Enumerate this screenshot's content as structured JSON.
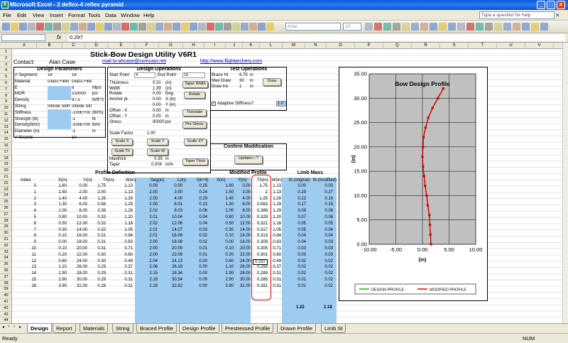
{
  "app": {
    "title": "Microsoft Excel - 2 deflex-4 reflex pyramid",
    "help_placeholder": "Type a question for help",
    "cell_value": "0.297",
    "font_name": "Arial",
    "font_size": "10",
    "fx": "fx"
  },
  "menu": [
    "File",
    "Edit",
    "View",
    "Insert",
    "Format",
    "Tools",
    "Data",
    "Window",
    "Help"
  ],
  "columns": [
    "A",
    "B",
    "C",
    "D",
    "E",
    "F",
    "G",
    "H",
    "I",
    "J",
    "K",
    "L",
    "M",
    "N",
    "O",
    "P",
    "Q",
    "R",
    "S",
    "T",
    "U",
    "V"
  ],
  "rows": [
    "1",
    "2",
    "3",
    "4",
    "5",
    "6",
    "7",
    "8",
    "9",
    "10",
    "11",
    "12",
    "13",
    "14",
    "15",
    "16",
    "17",
    "18",
    "19",
    "20",
    "21",
    "22",
    "23",
    "24",
    "25",
    "26",
    "27",
    "28",
    "29",
    "30",
    "31",
    "32",
    "33",
    "34",
    "35",
    "36",
    "37",
    "38",
    "39",
    "40",
    "41",
    "42",
    "43",
    "44"
  ],
  "sheet": {
    "title": "Stick-Bow Design Utility V6R1",
    "contact_label": "Contact:",
    "contact_name": "Alan Case",
    "email": "mail to:ahcase@comcast.net",
    "website": "http://www.flightarchery.com",
    "design_params": {
      "title": "Design Parameters",
      "rows": [
        {
          "label": "# Segments",
          "value": "16",
          "v2": "16"
        },
        {
          "label": "Material",
          "value": "Glass Fiber (GC",
          "v2": "Glass Fiber (GC-F"
        },
        {
          "label": "E",
          "value": "",
          "v2": "8",
          "unit": "Mpsi"
        },
        {
          "label": "MOR",
          "value": "",
          "v2": "210000",
          "unit": "psi"
        },
        {
          "label": "Density",
          "value": "",
          "v2": "97.5",
          "unit": "lb/ft^3"
        },
        {
          "label": "String",
          "value": "Infinite Stiffness",
          "v2": "Infinite Stiffness"
        },
        {
          "label": "Stiffness",
          "value": "",
          "v2": "-100E+00",
          "unit": "(lb/%)"
        },
        {
          "label": "Strength (lb)",
          "value": "",
          "v2": "-1",
          "unit": "lb"
        },
        {
          "label": "Density(lb/in)",
          "value": "",
          "v2": "-100E+00",
          "unit": "lb/in"
        },
        {
          "label": "Diameter (in)",
          "value": "",
          "v2": "-1",
          "unit": "in"
        },
        {
          "label": "# Strands",
          "value": "",
          "v2": "10",
          "unit": ""
        }
      ]
    },
    "design_ops": {
      "title": "Design Operations",
      "start_label": "Start Point",
      "start_val": "4",
      "end_label": "End Point",
      "end_val": "16",
      "rows": [
        {
          "label": "Thickness",
          "value": "0.31",
          "unit": "(in)"
        },
        {
          "label": "Width",
          "value": "1.39",
          "unit": "(in)"
        },
        {
          "label": "Rotate",
          "value": "0.00",
          "unit": "Deg"
        },
        {
          "label": "Anchor pt.",
          "value": "0.00",
          "unit": "X (in)"
        },
        {
          "label": "",
          "value": "0.00",
          "unit": "Y (in)"
        },
        {
          "label": "Offset - X",
          "value": "0.00",
          "unit": "in"
        },
        {
          "label": "Offset - Y",
          "value": "0.00",
          "unit": "in"
        },
        {
          "label": "Stress",
          "value": "90000",
          "unit": "psi"
        }
      ],
      "scale_factor_label": "Scale Factor",
      "scale_factor": "1.00",
      "masthick_label": "Masthick",
      "masthick": "0.39",
      "masthick_unit": "in",
      "taper_label": "Taper",
      "taper": "0.004",
      "taper_unit": "in/in",
      "buttons": {
        "taper_width": "Taper Width",
        "rotate": "Rotate",
        "translate": "Translate",
        "prestress": "Pre Stress",
        "scale_x": "Scale X",
        "scale_y": "Scale Y",
        "scale_xy": "Scale XY",
        "scale_th": "Scale Th",
        "scale_w": "Scale W",
        "taper_thick": "Taper Thick"
      }
    },
    "test_ops": {
      "title": "Test Operations",
      "rows": [
        {
          "label": "Brace Ht",
          "value": "6.75",
          "unit": "in"
        },
        {
          "label": "Max Draw",
          "value": "30",
          "unit": "in"
        },
        {
          "label": "Draw Inc",
          "value": "1",
          "unit": "in"
        }
      ],
      "draw_btn": "Draw",
      "adaptive": "Adaptive Stiffness?",
      "adaptive_val": "1.0"
    },
    "confirm": {
      "title": "Confirm Modification",
      "button": "Update<--?"
    },
    "profile_def": {
      "title": "Profile Definition",
      "headers": [
        "Index",
        "X(in)",
        "Y(in)",
        "Th(in)",
        "W(in)",
        "Seg(in)",
        "L(in)",
        "I(in^4)"
      ]
    },
    "modified": {
      "title": "Modified Profile",
      "headers": [
        "X(in)",
        "Y(in)",
        "Th(in)",
        "W(in)"
      ]
    },
    "limb_mass": {
      "title": "Limb Mass",
      "headers": [
        "lb (original)",
        "lb (modified)"
      ],
      "total_orig": "1.22",
      "total_mod": "1.18"
    },
    "table": [
      [
        "0",
        "1.60",
        "0.00",
        "1.75",
        "1.13",
        "0.00",
        "0.00",
        "0.25",
        "1.60",
        "0.00",
        "1.75",
        "1.13",
        "0.00",
        "0.00"
      ],
      [
        "1",
        "1.50",
        "2.00",
        "2.00",
        "1.13",
        "2.00",
        "2.00",
        "0.24",
        "1.50",
        "2.00",
        "2",
        "1.13",
        "0.29",
        "0.27"
      ],
      [
        "2",
        "1.40",
        "4.00",
        "1.25",
        "1.29",
        "2.00",
        "4.00",
        "0.29",
        "1.40",
        "4.00",
        "1.25",
        "1.29",
        "0.22",
        "0.19"
      ],
      [
        "3",
        "1.30",
        "6.00",
        "0.56",
        "1.29",
        "2.00",
        "6.01",
        "0.13",
        "1.30",
        "6.00",
        "0.563",
        "1.29",
        "0.17",
        "0.15"
      ],
      [
        "4",
        "1.00",
        "8.00",
        "0.39",
        "1.29",
        "2.02",
        "8.03",
        "0.06",
        "1.00",
        "8.00",
        "0.389",
        "1.29",
        "0.09",
        "0.08"
      ],
      [
        "5",
        "0.80",
        "10.00",
        "0.33",
        "1.20",
        "2.01",
        "10.04",
        "0.04",
        "0.80",
        "10.00",
        "0.329",
        "1.20",
        "0.07",
        "0.06"
      ],
      [
        "6",
        "0.50",
        "12.00",
        "0.32",
        "1.16",
        "2.02",
        "12.06",
        "0.04",
        "0.50",
        "12.00",
        "0.321",
        "1.16",
        "0.05",
        "0.05"
      ],
      [
        "7",
        "0.30",
        "14.00",
        "0.32",
        "1.05",
        "2.01",
        "14.07",
        "0.03",
        "0.30",
        "14.00",
        "0.317",
        "1.05",
        "0.05",
        "0.04"
      ],
      [
        "8",
        "0.10",
        "16.00",
        "0.31",
        "0.94",
        "2.01",
        "16.08",
        "0.02",
        "0.10",
        "16.00",
        "0.313",
        "0.94",
        "0.04",
        "0.04"
      ],
      [
        "9",
        "0.00",
        "18.00",
        "0.31",
        "0.83",
        "2.00",
        "18.08",
        "0.02",
        "0.00",
        "18.00",
        "0.309",
        "0.83",
        "0.04",
        "0.03"
      ],
      [
        "10",
        "0.10",
        "20.00",
        "0.31",
        "0.71",
        "2.00",
        "20.09",
        "0.01",
        "0.10",
        "20.00",
        "0.305",
        "0.71",
        "0.03",
        "0.03"
      ],
      [
        "11",
        "0.20",
        "22.00",
        "0.30",
        "0.60",
        "2.00",
        "22.09",
        "0.01",
        "0.20",
        "22.00",
        "0.301",
        "0.60",
        "0.03",
        "0.03"
      ],
      [
        "12",
        "0.60",
        "24.00",
        "0.30",
        "0.49",
        "2.04",
        "24.13",
        "0.00",
        "0.60",
        "24.00",
        "0.297",
        "0.49",
        "0.02",
        "0.02"
      ],
      [
        "13",
        "1.10",
        "26.00",
        "0.29",
        "0.37",
        "2.06",
        "26.19",
        "0.00",
        "1.10",
        "26.00",
        "0.293",
        "0.37",
        "0.02",
        "0.02"
      ],
      [
        "14",
        "1.90",
        "28.00",
        "0.29",
        "0.31",
        "2.15",
        "28.34",
        "0.00",
        "1.90",
        "28.00",
        "0.289",
        "0.31",
        "0.02",
        "0.02"
      ],
      [
        "15",
        "2.90",
        "30.00",
        "0.29",
        "0.31",
        "2.16",
        "30.54",
        "0.00",
        "2.90",
        "30.00",
        "0.285",
        "0.31",
        "0.01",
        "0.02"
      ],
      [
        "16",
        "3.90",
        "32.00",
        "0.28",
        "0.31",
        "2.28",
        "32.82",
        "0.00",
        "3.90",
        "32.00",
        "0.281",
        "0.31",
        "0.01",
        "0.02"
      ]
    ]
  },
  "chart_data": {
    "type": "scatter",
    "title": "Bow Design Profile",
    "xlabel": "(in)",
    "ylabel": "(in)",
    "xlim": [
      -10,
      10
    ],
    "ylim": [
      0,
      35
    ],
    "xticks": [
      "-10.00",
      "-5.00",
      "0.00",
      "5.00",
      "10.00"
    ],
    "yticks": [
      "0.00",
      "5.00",
      "10.00",
      "15.00",
      "20.00",
      "25.00",
      "30.00",
      "35.00"
    ],
    "series": [
      {
        "name": "DESIGN PROFILE",
        "color": "#00c000",
        "x": [
          1.6,
          1.5,
          1.4,
          1.3,
          1.0,
          0.8,
          0.5,
          0.3,
          0.1,
          0.0,
          0.1,
          0.2,
          0.6,
          1.1,
          1.9,
          2.9,
          3.9
        ],
        "y": [
          0,
          2,
          4,
          6,
          8,
          10,
          12,
          14,
          16,
          18,
          20,
          22,
          24,
          26,
          28,
          30,
          32
        ]
      },
      {
        "name": "MODIFIED PROFILE",
        "color": "#e00000",
        "x": [
          1.6,
          1.5,
          1.4,
          1.3,
          1.0,
          0.8,
          0.5,
          0.3,
          0.1,
          0.0,
          0.1,
          0.2,
          0.6,
          1.1,
          1.9,
          2.9,
          3.9
        ],
        "y": [
          0,
          2,
          4,
          6,
          8,
          10,
          12,
          14,
          16,
          18,
          20,
          22,
          24,
          26,
          28,
          30,
          32
        ]
      }
    ],
    "grid": true,
    "legend": "bottom"
  },
  "tabs": [
    "Design",
    "Report",
    "Materials",
    "String",
    "Braced Profile",
    "Design Profile",
    "Prestressed Profile",
    "Drawn Profile",
    "Limb St"
  ],
  "status": {
    "left": "Ready",
    "right": "NUM"
  }
}
